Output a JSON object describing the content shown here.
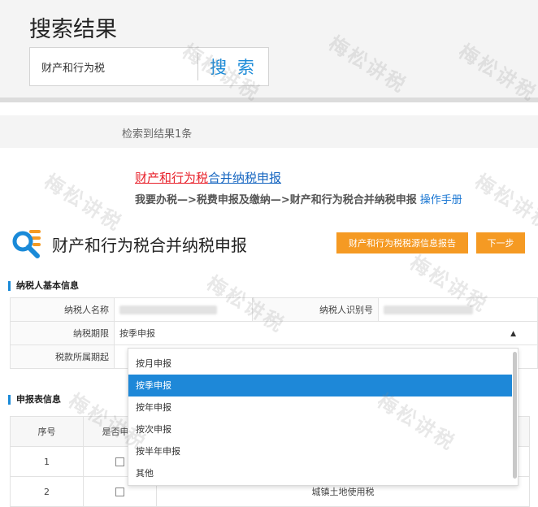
{
  "header": {
    "title": "搜索结果"
  },
  "search": {
    "value": "财产和行为税",
    "button_label": "搜 索"
  },
  "results": {
    "count_text": "检索到结果1条",
    "item": {
      "title_highlight": "财产和行为税",
      "title_rest": "合并纳税申报",
      "path": "我要办税—>税费申报及缴纳—>财产和行为税合并纳税申报",
      "manual_link": "操作手册"
    }
  },
  "form": {
    "title": "财产和行为税合并纳税申报",
    "buttons": {
      "report": "财产和行为税税源信息报告",
      "next": "下一步"
    },
    "section_basic": "纳税人基本信息",
    "basic_fields": {
      "taxpayer_name_label": "纳税人名称",
      "taxpayer_id_label": "纳税人识别号",
      "period_label": "纳税期限",
      "period_value": "按季申报",
      "tax_period_label": "税款所属期起"
    },
    "section_declaration": "申报表信息",
    "declaration_table": {
      "headers": [
        "序号",
        "是否申报"
      ],
      "rows": [
        {
          "index": "1",
          "name": ""
        },
        {
          "index": "2",
          "name": "城镇土地使用税"
        }
      ]
    }
  },
  "dropdown": {
    "options": [
      "按月申报",
      "按季申报",
      "按年申报",
      "按次申报",
      "按半年申报",
      "其他"
    ],
    "selected_index": 1
  },
  "watermark": {
    "text": "梅松讲税"
  },
  "colors": {
    "accent": "#1a8ad8",
    "orange": "#f59a23",
    "highlight": "#e8202a",
    "selected": "#1e88d8"
  }
}
